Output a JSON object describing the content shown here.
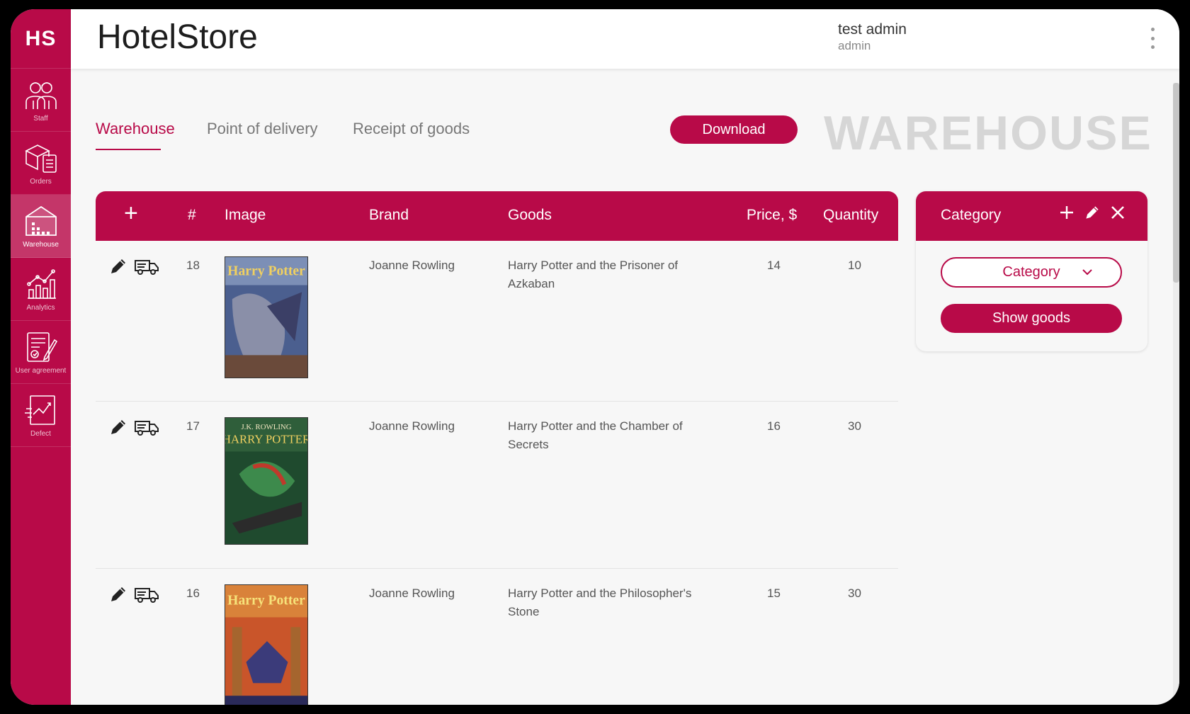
{
  "app": {
    "logo": "HS",
    "title": "HotelStore"
  },
  "user": {
    "name": "test admin",
    "role": "admin"
  },
  "sidebar": {
    "items": [
      {
        "label": "Staff",
        "icon": "staff-icon",
        "active": false
      },
      {
        "label": "Orders",
        "icon": "orders-icon",
        "active": false
      },
      {
        "label": "Warehouse",
        "icon": "warehouse-icon",
        "active": true
      },
      {
        "label": "Analytics",
        "icon": "analytics-icon",
        "active": false
      },
      {
        "label": "User agreement",
        "icon": "user-agreement-icon",
        "active": false
      },
      {
        "label": "Defect",
        "icon": "defect-icon",
        "active": false
      }
    ]
  },
  "tabs": [
    {
      "label": "Warehouse",
      "active": true
    },
    {
      "label": "Point of delivery",
      "active": false
    },
    {
      "label": "Receipt of goods",
      "active": false
    }
  ],
  "toolbar": {
    "download_label": "Download"
  },
  "page_heading": "WAREHOUSE",
  "table": {
    "add_symbol": "+",
    "headers": {
      "num": "#",
      "image": "Image",
      "brand": "Brand",
      "goods": "Goods",
      "price": "Price, $",
      "quantity": "Quantity"
    },
    "rows": [
      {
        "num": "18",
        "brand": "Joanne Rowling",
        "goods": "Harry Potter and the Prisoner of Azkaban",
        "price": "14",
        "quantity": "10",
        "cover": "prisoner-of-azkaban-cover"
      },
      {
        "num": "17",
        "brand": "Joanne Rowling",
        "goods": "Harry Potter and the Chamber of Secrets",
        "price": "16",
        "quantity": "30",
        "cover": "chamber-of-secrets-cover"
      },
      {
        "num": "16",
        "brand": "Joanne Rowling",
        "goods": "Harry Potter and the Philosopher's Stone",
        "price": "15",
        "quantity": "30",
        "cover": "philosophers-stone-cover"
      }
    ]
  },
  "category_panel": {
    "title": "Category",
    "select_value": "Category",
    "show_label": "Show goods"
  },
  "colors": {
    "brand": "#b80a48",
    "heading_watermark": "#d6d6d6",
    "background": "#f7f7f7"
  }
}
